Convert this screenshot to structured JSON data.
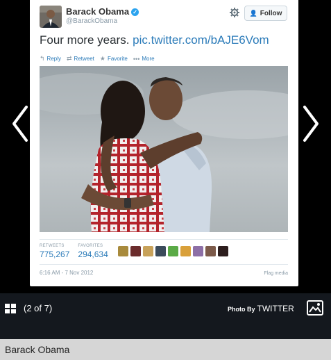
{
  "tweet": {
    "author_name": "Barack Obama",
    "author_handle": "@BarackObama",
    "verified_mark": "✓",
    "follow_label": "Follow",
    "text": "Four more years.",
    "link": "pic.twitter.com/bAJE6Vom",
    "actions": [
      {
        "icon": "reply-icon",
        "label": "Reply"
      },
      {
        "icon": "retweet-icon",
        "label": "Retweet"
      },
      {
        "icon": "star-icon",
        "label": "Favorite"
      },
      {
        "icon": "more-icon",
        "label": "More"
      }
    ],
    "retweets_label": "RETWEETS",
    "retweets_value": "775,267",
    "favorites_label": "FAVORITES",
    "favorites_value": "294,634",
    "timestamp": "6:16 AM - 7 Nov 2012",
    "flag_label": "Flag media"
  },
  "slideshow": {
    "counter": "(2 of 7)",
    "photo_by": "Photo By",
    "credit": "TWITTER",
    "caption": "Barack Obama"
  },
  "colors": {
    "link": "#2b7bb9",
    "bar": "#14181e",
    "caption_bg": "#d6d6d6"
  }
}
